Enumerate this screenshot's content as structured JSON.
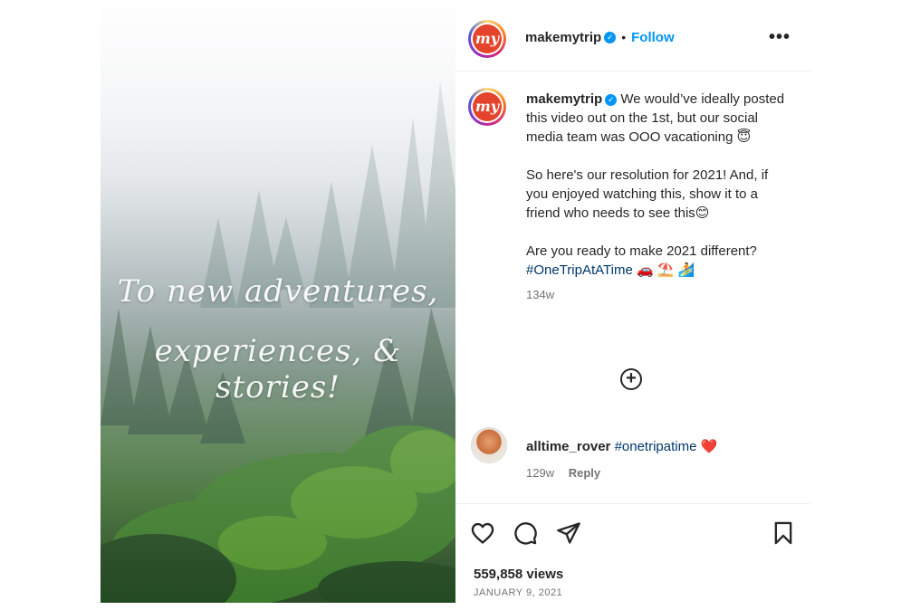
{
  "post": {
    "author": "makemytrip",
    "follow_label": "Follow",
    "separator": "•",
    "more_label": "•••",
    "logo_text": "my",
    "verified_mark": "✓",
    "overlay_text": {
      "line1": "To new adventures,",
      "line2": "experiences, & stories!"
    },
    "caption": {
      "username": "makemytrip",
      "paragraph1": "We would’ve ideally posted this video out on the 1st, but our social media team was OOO vacationing 😇",
      "paragraph2": "So here's our resolution for 2021! And, if you enjoyed watching this, show it to a friend who needs to see this😊",
      "paragraph3": "Are you ready to make 2021 different?",
      "hashtag": "#OneTripAtATime",
      "emojis": "🚗 ⛱️ 🏄",
      "age": "134w"
    },
    "load_more_label": "+",
    "comment": {
      "username": "alltime_rover",
      "text": "#onetripatime",
      "emoji": "❤️",
      "age": "129w",
      "reply_label": "Reply"
    },
    "views": "559,858 views",
    "date": "JANUARY 9, 2021"
  },
  "icons": [
    "heart-icon",
    "comment-icon",
    "share-icon",
    "bookmark-icon",
    "more-icon",
    "verified-icon",
    "plus-circle-icon"
  ],
  "colors": {
    "accent": "#0095f6",
    "brand": "#e3442b",
    "text": "#262626",
    "muted": "#737373"
  }
}
